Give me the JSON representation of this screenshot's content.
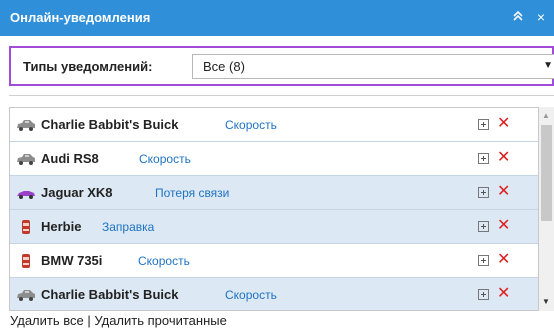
{
  "window": {
    "title": "Онлайн-уведомления",
    "collapse_glyph": "«",
    "close_glyph": "×"
  },
  "filter": {
    "label": "Типы уведомлений:",
    "selected": "Все (8)"
  },
  "notifications": [
    {
      "vehicle": "Charlie Babbit's Buick",
      "event": "Скорость",
      "unread": false,
      "icon": "sedan-grey-icon"
    },
    {
      "vehicle": "Audi RS8",
      "event": "Скорость",
      "unread": false,
      "icon": "sedan-grey-icon"
    },
    {
      "vehicle": "Jaguar XK8",
      "event": "Потеря связи",
      "unread": true,
      "icon": "sports-car-purple-icon"
    },
    {
      "vehicle": "Herbie",
      "event": "Заправка",
      "unread": true,
      "icon": "car-top-red-icon"
    },
    {
      "vehicle": "BMW 735i",
      "event": "Скорость",
      "unread": false,
      "icon": "car-top-red-icon"
    },
    {
      "vehicle": "Charlie Babbit's Buick",
      "event": "Скорость",
      "unread": true,
      "icon": "sedan-grey-icon"
    }
  ],
  "footer": {
    "delete_all": "Удалить все",
    "divider": "|",
    "delete_read": "Удалить прочитанные"
  },
  "colors": {
    "header": "#2f8fd8",
    "filter_border": "#a24bd6",
    "unread_row": "#dce8f3",
    "event_link": "#1f73c2",
    "delete": "#e02020"
  }
}
